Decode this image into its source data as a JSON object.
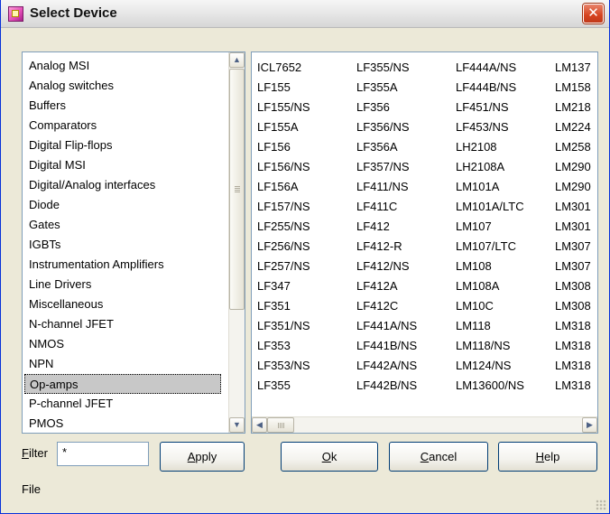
{
  "window": {
    "title": "Select Device",
    "close_label": "✕"
  },
  "categories": {
    "items": [
      "Analog MSI",
      "Analog switches",
      "Buffers",
      "Comparators",
      "Digital Flip-flops",
      "Digital MSI",
      "Digital/Analog interfaces",
      "Diode",
      "Gates",
      "IGBTs",
      "Instrumentation Amplifiers",
      "Line Drivers",
      "Miscellaneous",
      "N-channel JFET",
      "NMOS",
      "NPN",
      "Op-amps",
      "P-channel JFET",
      "PMOS"
    ],
    "selected": "Op-amps"
  },
  "devices": {
    "columns": [
      [
        "ICL7652",
        "LF155",
        "LF155/NS",
        "LF155A",
        "LF156",
        "LF156/NS",
        "LF156A",
        "LF157/NS",
        "LF255/NS",
        "LF256/NS",
        "LF257/NS",
        "LF347",
        "LF351",
        "LF351/NS",
        "LF353",
        "LF353/NS",
        "LF355"
      ],
      [
        "LF355/NS",
        "LF355A",
        "LF356",
        "LF356/NS",
        "LF356A",
        "LF357/NS",
        "LF411/NS",
        "LF411C",
        "LF412",
        "LF412-R",
        "LF412/NS",
        "LF412A",
        "LF412C",
        "LF441A/NS",
        "LF441B/NS",
        "LF442A/NS",
        "LF442B/NS"
      ],
      [
        "LF444A/NS",
        "LF444B/NS",
        "LF451/NS",
        "LF453/NS",
        "LH2108",
        "LH2108A",
        "LM101A",
        "LM101A/LTC",
        "LM107",
        "LM107/LTC",
        "LM108",
        "LM108A",
        "LM10C",
        "LM118",
        "LM118/NS",
        "LM124/NS",
        "LM13600/NS"
      ],
      [
        "LM137",
        "LM158",
        "LM218",
        "LM224",
        "LM258",
        "LM290",
        "LM290",
        "LM301",
        "LM301",
        "LM307",
        "LM307",
        "LM308",
        "LM308",
        "LM318",
        "LM318",
        "LM318",
        "LM318"
      ]
    ]
  },
  "filter": {
    "label": "Filter",
    "value": "*"
  },
  "buttons": {
    "apply": "Apply",
    "ok": "Ok",
    "cancel": "Cancel",
    "help": "Help"
  },
  "status": {
    "text": "File"
  }
}
